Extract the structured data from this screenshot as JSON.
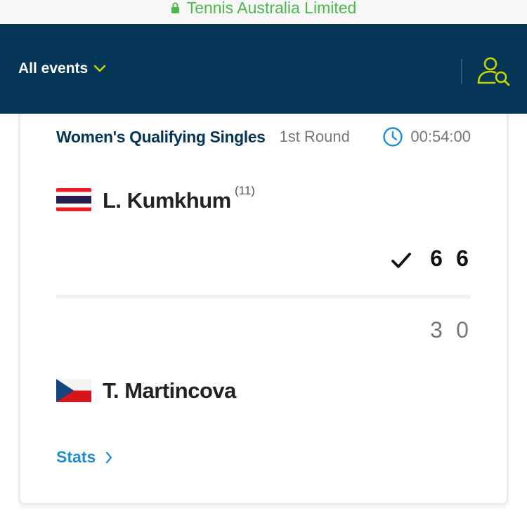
{
  "browser": {
    "url_host": "Tennis Australia Limited",
    "lock_icon": "lock-icon"
  },
  "header": {
    "events_label": "All events",
    "events_chevron_icon": "chevron-down-icon",
    "account_icon": "user-search-icon",
    "accent_color": "#c8d400",
    "background_color": "#053657"
  },
  "match": {
    "event_name": "Women's Qualifying Singles",
    "round": "1st Round",
    "clock_icon": "clock-icon",
    "duration": "00:54:00",
    "player1": {
      "name": "L. Kumkhum",
      "seed": "(11)",
      "flag": "thailand-flag-icon",
      "winner_icon": "checkmark-icon",
      "set1": "6",
      "set2": "6"
    },
    "player2": {
      "name": "T. Martincova",
      "flag": "czech-flag-icon",
      "set1": "3",
      "set2": "0"
    },
    "stats_label": "Stats",
    "stats_icon": "chevron-right-icon",
    "link_color": "#1f8ecd"
  }
}
